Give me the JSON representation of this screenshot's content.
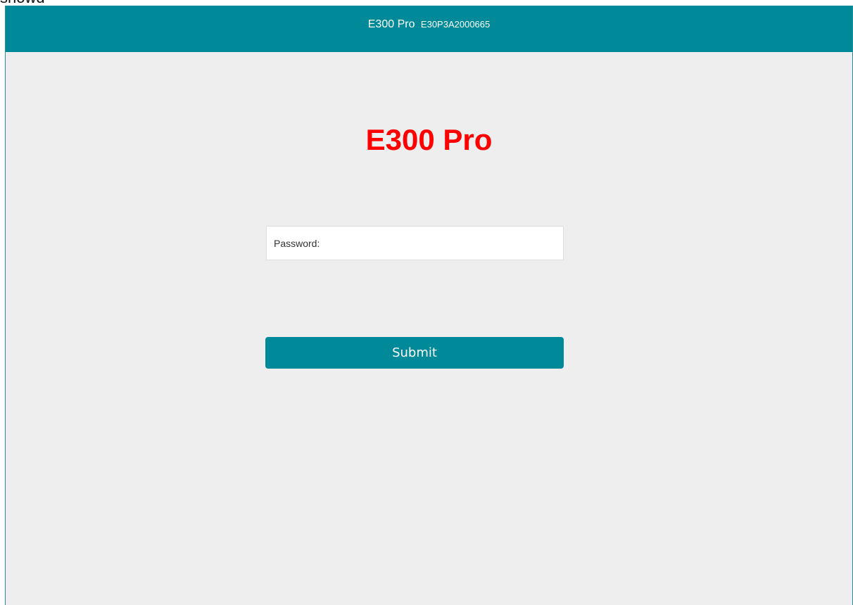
{
  "header": {
    "model": "E300 Pro",
    "serial": "E30P3A2000665"
  },
  "main": {
    "product_title": "E300 Pro"
  },
  "login_form": {
    "password_label": "Password:",
    "password_value": "",
    "submit_label": "Submit"
  },
  "top_fragment": "showd",
  "colors": {
    "header_bg": "#008a99",
    "page_bg": "#eeeeee",
    "title_red": "#ff0000",
    "button_bg": "#008a99"
  }
}
